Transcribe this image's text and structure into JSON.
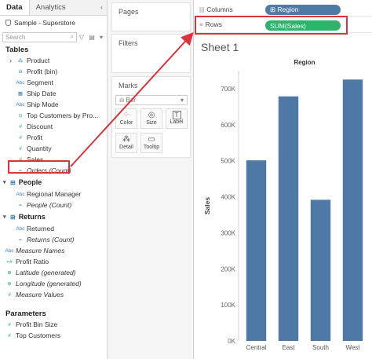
{
  "data_pane": {
    "tabs": [
      {
        "label": "Data"
      },
      {
        "label": "Analytics"
      }
    ],
    "collapse_glyph": "‹",
    "datasource": "Sample - Superstore",
    "search_placeholder": "Search",
    "search_icons": "▽ ▤ ▾",
    "tables_title": "Tables",
    "product_fields": [
      {
        "label": "Product",
        "icon": "⁂",
        "italic": false,
        "measure": false,
        "expand": true
      },
      {
        "label": "Profit (bin)",
        "icon": "ılı",
        "italic": false,
        "measure": false
      },
      {
        "label": "Segment",
        "icon": "Abc",
        "italic": false,
        "measure": false
      },
      {
        "label": "Ship Date",
        "icon": "▦",
        "italic": false,
        "measure": false
      },
      {
        "label": "Ship Mode",
        "icon": "Abc",
        "italic": false,
        "measure": false
      },
      {
        "label": "Top Customers by Pro...",
        "icon": "⊙",
        "italic": false,
        "measure": false
      },
      {
        "label": "Discount",
        "icon": "#",
        "italic": false,
        "measure": true
      },
      {
        "label": "Profit",
        "icon": "#",
        "italic": false,
        "measure": true
      },
      {
        "label": "Quantity",
        "icon": "#",
        "italic": false,
        "measure": true
      },
      {
        "label": "Sales",
        "icon": "#",
        "italic": false,
        "measure": true
      },
      {
        "label": "Orders (Count)",
        "icon": "=",
        "italic": true,
        "measure": true
      }
    ],
    "people_group": {
      "label": "People",
      "fields": [
        {
          "label": "Regional Manager",
          "icon": "Abc",
          "italic": false,
          "measure": false
        },
        {
          "label": "People (Count)",
          "icon": "=",
          "italic": true,
          "measure": true
        }
      ]
    },
    "returns_group": {
      "label": "Returns",
      "fields": [
        {
          "label": "Returned",
          "icon": "Abc",
          "italic": false,
          "measure": false
        },
        {
          "label": "Returns (Count)",
          "icon": "=",
          "italic": true,
          "measure": true
        }
      ]
    },
    "bottom_fields": [
      {
        "label": "Measure Names",
        "icon": "Abc",
        "italic": true,
        "measure": false
      },
      {
        "label": "Profit Ratio",
        "icon": "=#",
        "italic": false,
        "measure": true
      },
      {
        "label": "Latitude (generated)",
        "icon": "⊕",
        "italic": true,
        "measure": true
      },
      {
        "label": "Longitude (generated)",
        "icon": "⊕",
        "italic": true,
        "measure": true
      },
      {
        "label": "Measure Values",
        "icon": "#",
        "italic": true,
        "measure": true
      }
    ],
    "parameters_title": "Parameters",
    "parameters": [
      {
        "label": "Profit Bin Size",
        "icon": "#",
        "italic": false,
        "measure": true
      },
      {
        "label": "Top Customers",
        "icon": "#",
        "italic": false,
        "measure": true
      }
    ]
  },
  "shelves": {
    "pages_label": "Pages",
    "filters_label": "Filters",
    "marks_label": "Marks",
    "mark_type": "ılı Bar",
    "mark_buttons": [
      {
        "label": "Color",
        "icon": "⁘"
      },
      {
        "label": "Size",
        "icon": "◎"
      },
      {
        "label": "Label",
        "icon": "T"
      },
      {
        "label": "Detail",
        "icon": "⁂"
      },
      {
        "label": "Tooltip",
        "icon": "▭"
      }
    ],
    "columns_label": "Columns",
    "columns_icon": "|||",
    "columns_pill": "⊞ Region",
    "rows_label": "Rows",
    "rows_icon": "≡",
    "rows_pill": "SUM(Sales)"
  },
  "sheet": {
    "title": "Sheet 1"
  },
  "chart_data": {
    "type": "bar",
    "title": "Region",
    "xlabel": "",
    "ylabel": "Sales",
    "categories": [
      "Central",
      "East",
      "South",
      "West"
    ],
    "values": [
      501240,
      678781,
      391722,
      725458
    ],
    "y_ticks": [
      "0K",
      "100K",
      "200K",
      "300K",
      "400K",
      "500K",
      "600K",
      "700K"
    ],
    "ylim": [
      0,
      750000
    ],
    "bar_color": "#4e79a7",
    "grid": false
  },
  "colors": {
    "highlight": "#d9333b",
    "dimension_pill": "#4e7aa6",
    "measure_pill": "#2bb56b"
  }
}
